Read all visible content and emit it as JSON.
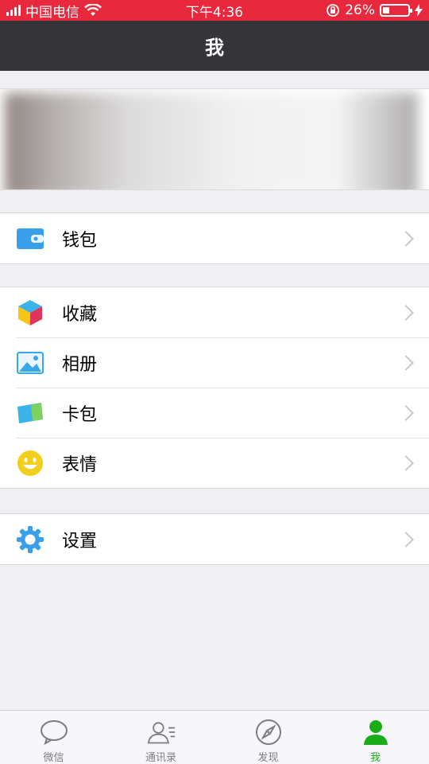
{
  "status_bar": {
    "carrier": "中国电信",
    "time": "下午4:36",
    "battery_percent": "26%",
    "battery_level": 0.26
  },
  "nav": {
    "title": "我"
  },
  "menu": {
    "wallet": "钱包",
    "favorites": "收藏",
    "album": "相册",
    "cards": "卡包",
    "stickers": "表情",
    "settings": "设置"
  },
  "tabs": [
    {
      "label": "微信",
      "icon": "chat-icon",
      "active": false
    },
    {
      "label": "通讯录",
      "icon": "contacts-icon",
      "active": false
    },
    {
      "label": "发现",
      "icon": "compass-icon",
      "active": false
    },
    {
      "label": "我",
      "icon": "person-icon",
      "active": true
    }
  ],
  "colors": {
    "status_bar": "#e8283c",
    "nav_bar": "#353539",
    "active_tab": "#1aad19"
  }
}
